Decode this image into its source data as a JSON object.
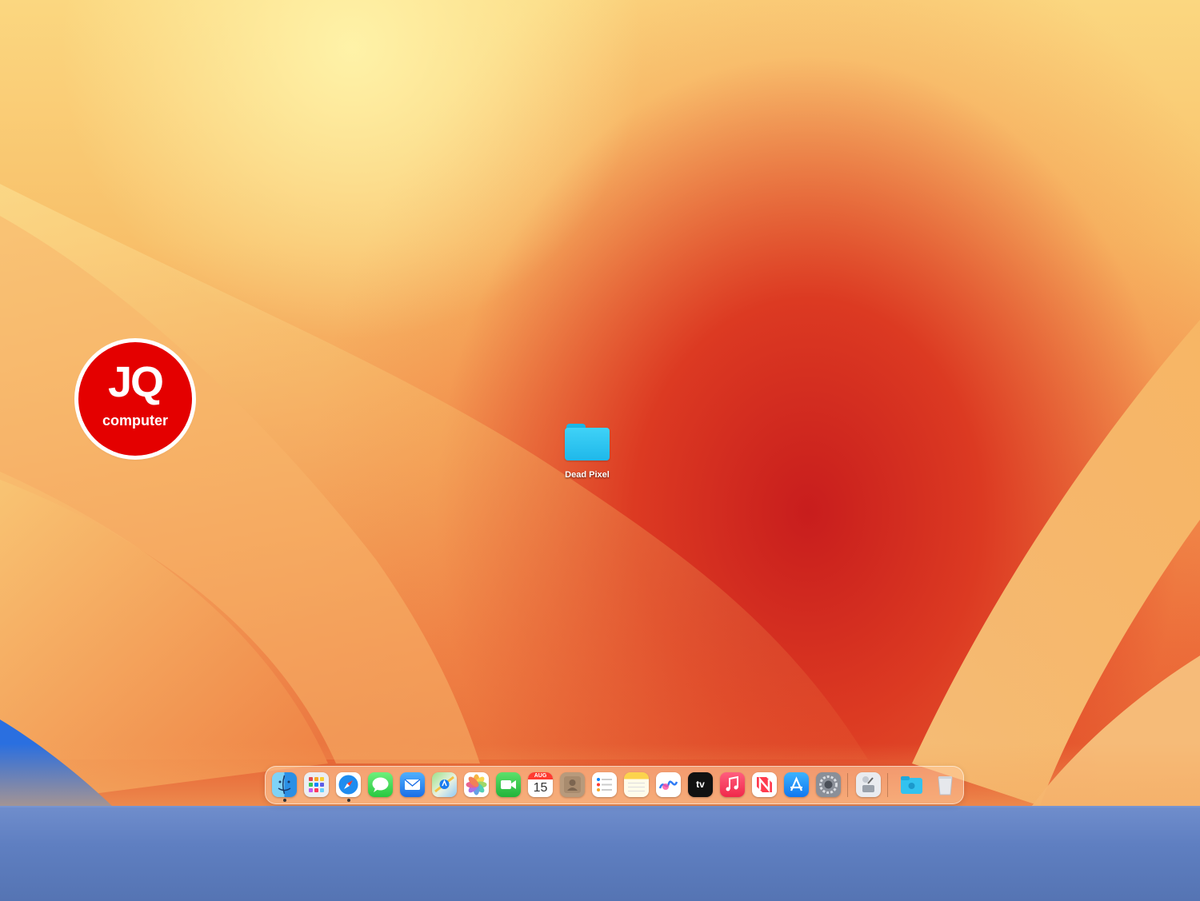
{
  "desktop": {
    "folder_label": "Dead Pixel",
    "wallpaper": "macOS Ventura orange"
  },
  "logo": {
    "main": "JQ",
    "sub": "computer",
    "color": "#e40000"
  },
  "calendar": {
    "month": "AUG",
    "day": "15"
  },
  "tv_label": "tv",
  "dock": {
    "apps": [
      {
        "name": "Finder",
        "icon": "finder-icon",
        "running": true
      },
      {
        "name": "Launchpad",
        "icon": "launchpad-icon",
        "running": false
      },
      {
        "name": "Safari",
        "icon": "safari-icon",
        "running": true
      },
      {
        "name": "Messages",
        "icon": "messages-icon",
        "running": false
      },
      {
        "name": "Mail",
        "icon": "mail-icon",
        "running": false
      },
      {
        "name": "Maps",
        "icon": "maps-icon",
        "running": false
      },
      {
        "name": "Photos",
        "icon": "photos-icon",
        "running": false
      },
      {
        "name": "FaceTime",
        "icon": "facetime-icon",
        "running": false
      },
      {
        "name": "Calendar",
        "icon": "calendar-icon",
        "running": false
      },
      {
        "name": "Contacts",
        "icon": "contacts-icon",
        "running": false
      },
      {
        "name": "Reminders",
        "icon": "reminders-icon",
        "running": false
      },
      {
        "name": "Notes",
        "icon": "notes-icon",
        "running": false
      },
      {
        "name": "Freeform",
        "icon": "freeform-icon",
        "running": false
      },
      {
        "name": "Apple TV",
        "icon": "apple-tv-icon",
        "running": false
      },
      {
        "name": "Music",
        "icon": "music-icon",
        "running": false
      },
      {
        "name": "News",
        "icon": "news-icon",
        "running": false
      },
      {
        "name": "App Store",
        "icon": "app-store-icon",
        "running": false
      },
      {
        "name": "System Settings",
        "icon": "system-settings-icon",
        "running": false
      },
      {
        "name": "Disk Utility",
        "icon": "disk-utility-icon",
        "running": false
      },
      {
        "name": "Downloads",
        "icon": "downloads-folder-icon",
        "running": false
      },
      {
        "name": "Trash",
        "icon": "trash-icon",
        "running": false
      }
    ]
  }
}
